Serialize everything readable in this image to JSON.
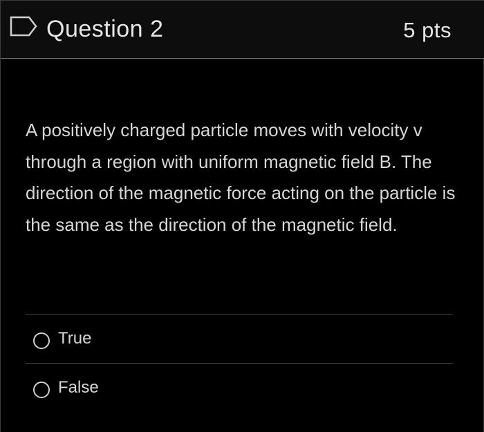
{
  "question": {
    "title": "Question 2",
    "points": "5 pts",
    "flag_icon": "flag-outline-icon",
    "text": "A positively charged particle moves with velocity v through a region with uniform magnetic field B. The direction of the magnetic force acting on the particle is the same as the direction of the magnetic field."
  },
  "answers": [
    {
      "label": "True",
      "selected": false
    },
    {
      "label": "False",
      "selected": false
    }
  ],
  "colors": {
    "background": "#000000",
    "header_background": "#0d0d0d",
    "text": "#d6d6d6",
    "divider": "#4a4a4a"
  }
}
